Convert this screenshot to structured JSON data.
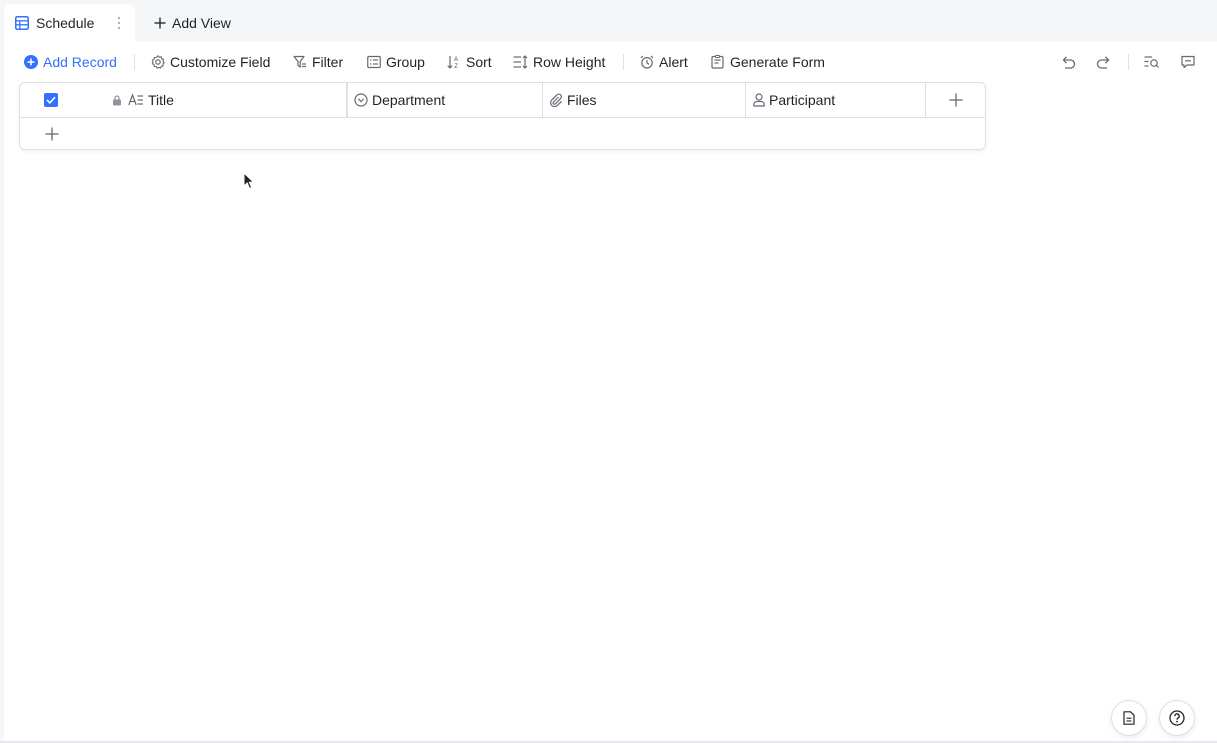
{
  "tabs": {
    "active_label": "Schedule",
    "add_view_label": "Add View"
  },
  "toolbar": {
    "add_record": "Add Record",
    "customize_field": "Customize Field",
    "filter": "Filter",
    "group": "Group",
    "sort": "Sort",
    "row_height": "Row Height",
    "alert": "Alert",
    "generate_form": "Generate Form"
  },
  "table": {
    "columns": [
      {
        "label": "Title",
        "icon": "text-field-icon",
        "locked": true
      },
      {
        "label": "Department",
        "icon": "single-select-icon"
      },
      {
        "label": "Files",
        "icon": "attachment-icon"
      },
      {
        "label": "Participant",
        "icon": "person-icon"
      }
    ],
    "rows": []
  },
  "colors": {
    "accent": "#3370ff",
    "border": "#dee0e3",
    "text": "#1f2329",
    "icon": "#646a73"
  }
}
